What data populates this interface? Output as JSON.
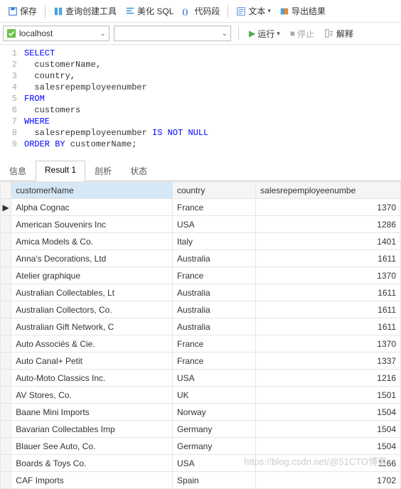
{
  "toolbar": {
    "save": "保存",
    "queryBuilder": "查询创建工具",
    "beautify": "美化 SQL",
    "snippet": "代码段",
    "textDropdown": "文本",
    "export": "导出结果"
  },
  "row2": {
    "host": "localhost",
    "run": "运行",
    "stop": "停止",
    "explain": "解释"
  },
  "sql": [
    {
      "n": 1,
      "tokens": [
        {
          "t": "SELECT",
          "kw": 1
        }
      ]
    },
    {
      "n": 2,
      "tokens": [
        {
          "t": "  customerName,",
          "kw": 0
        }
      ]
    },
    {
      "n": 3,
      "tokens": [
        {
          "t": "  country,",
          "kw": 0
        }
      ]
    },
    {
      "n": 4,
      "tokens": [
        {
          "t": "  salesrepemployeenumber",
          "kw": 0
        }
      ]
    },
    {
      "n": 5,
      "tokens": [
        {
          "t": "FROM",
          "kw": 1
        }
      ]
    },
    {
      "n": 6,
      "tokens": [
        {
          "t": "  customers",
          "kw": 0
        }
      ]
    },
    {
      "n": 7,
      "tokens": [
        {
          "t": "WHERE",
          "kw": 1
        }
      ]
    },
    {
      "n": 8,
      "tokens": [
        {
          "t": "  salesrepemployeenumber ",
          "kw": 0
        },
        {
          "t": "IS NOT NULL",
          "kw": 1
        }
      ]
    },
    {
      "n": 9,
      "tokens": [
        {
          "t": "ORDER BY",
          "kw": 1
        },
        {
          "t": " customerName;",
          "kw": 0
        }
      ]
    }
  ],
  "tabs": {
    "info": "信息",
    "result": "Result 1",
    "profile": "剖析",
    "status": "状态"
  },
  "columns": {
    "c1": "customerName",
    "c2": "country",
    "c3": "salesrepemployeenumbe"
  },
  "rows": [
    {
      "ptr": "▶",
      "c1": "Alpha Cognac",
      "c2": "France",
      "c3": "1370"
    },
    {
      "ptr": "",
      "c1": "American Souvenirs Inc",
      "c2": "USA",
      "c3": "1286"
    },
    {
      "ptr": "",
      "c1": "Amica Models & Co.",
      "c2": "Italy",
      "c3": "1401"
    },
    {
      "ptr": "",
      "c1": "Anna's Decorations, Ltd",
      "c2": "Australia",
      "c3": "1611"
    },
    {
      "ptr": "",
      "c1": "Atelier graphique",
      "c2": "France",
      "c3": "1370"
    },
    {
      "ptr": "",
      "c1": "Australian Collectables, Lt",
      "c2": "Australia",
      "c3": "1611"
    },
    {
      "ptr": "",
      "c1": "Australian Collectors, Co.",
      "c2": "Australia",
      "c3": "1611"
    },
    {
      "ptr": "",
      "c1": "Australian Gift Network, C",
      "c2": "Australia",
      "c3": "1611"
    },
    {
      "ptr": "",
      "c1": "Auto Associés & Cie.",
      "c2": "France",
      "c3": "1370"
    },
    {
      "ptr": "",
      "c1": "Auto Canal+ Petit",
      "c2": "France",
      "c3": "1337"
    },
    {
      "ptr": "",
      "c1": "Auto-Moto Classics Inc.",
      "c2": "USA",
      "c3": "1216"
    },
    {
      "ptr": "",
      "c1": "AV Stores, Co.",
      "c2": "UK",
      "c3": "1501"
    },
    {
      "ptr": "",
      "c1": "Baane Mini Imports",
      "c2": "Norway",
      "c3": "1504"
    },
    {
      "ptr": "",
      "c1": "Bavarian Collectables Imp",
      "c2": "Germany",
      "c3": "1504"
    },
    {
      "ptr": "",
      "c1": "Blauer See Auto, Co.",
      "c2": "Germany",
      "c3": "1504"
    },
    {
      "ptr": "",
      "c1": "Boards & Toys Co.",
      "c2": "USA",
      "c3": "1166"
    },
    {
      "ptr": "",
      "c1": "CAF Imports",
      "c2": "Spain",
      "c3": "1702"
    }
  ],
  "watermark": "https://blog.csdn.net/@51CTO博客"
}
